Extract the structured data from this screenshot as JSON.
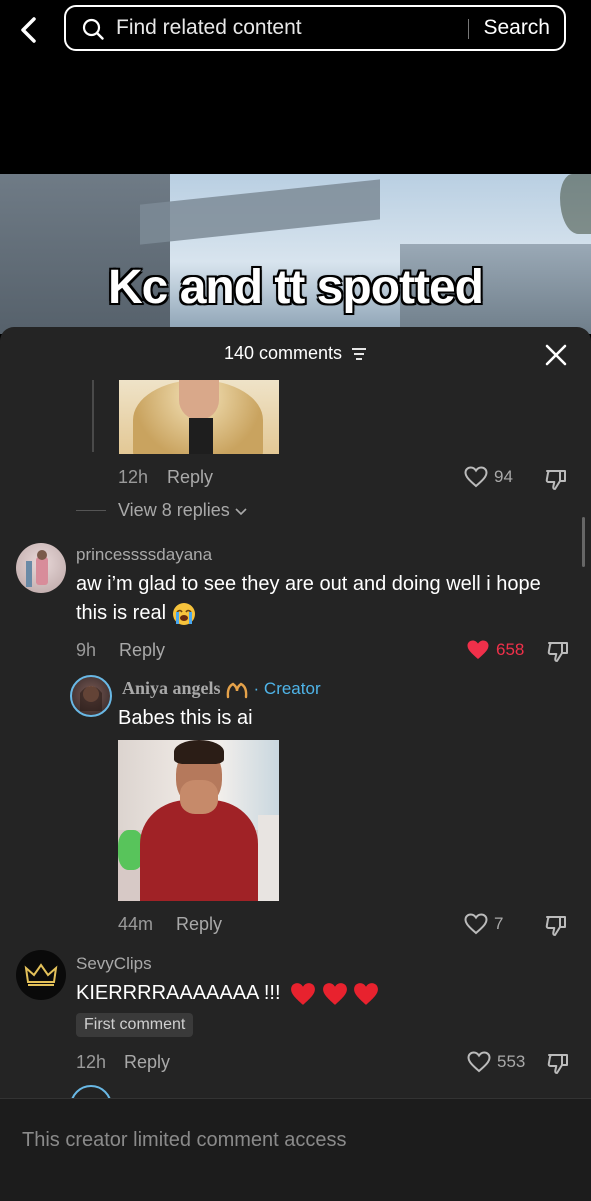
{
  "search": {
    "placeholder": "Find related content",
    "button_label": "Search"
  },
  "video": {
    "caption": "Kc and tt spotted"
  },
  "comments_sheet": {
    "title": "140 comments",
    "comments": [
      {
        "time": "12h",
        "reply_label": "Reply",
        "likes": "94",
        "liked": false,
        "view_replies": "View 8 replies"
      },
      {
        "username": "princessssdayana",
        "text": "aw i’m glad to see they are out and doing well i hope this is real",
        "time": "9h",
        "reply_label": "Reply",
        "likes": "658",
        "liked": true,
        "reply": {
          "username": "Aniya angels",
          "creator_label": "· Creator",
          "text": "Babes this is ai",
          "time": "44m",
          "reply_label": "Reply",
          "likes": "7"
        }
      },
      {
        "username": "SevyClips",
        "text": "KIERRRRAAAAAAA !!!",
        "badge": "First comment",
        "time": "12h",
        "reply_label": "Reply",
        "likes": "553"
      }
    ]
  },
  "footer": {
    "text": "This creator limited comment access"
  },
  "colors": {
    "sheet_bg": "#242424",
    "liked_heart": "#f0304a",
    "creator_tag": "#4fb4e8"
  },
  "icons": {
    "back": "chevron-left-icon",
    "search": "search-icon",
    "filter": "filter-icon",
    "close": "close-icon",
    "like": "heart-icon",
    "dislike": "dislike-icon",
    "emoji": "loudly-crying-face-emoji"
  }
}
